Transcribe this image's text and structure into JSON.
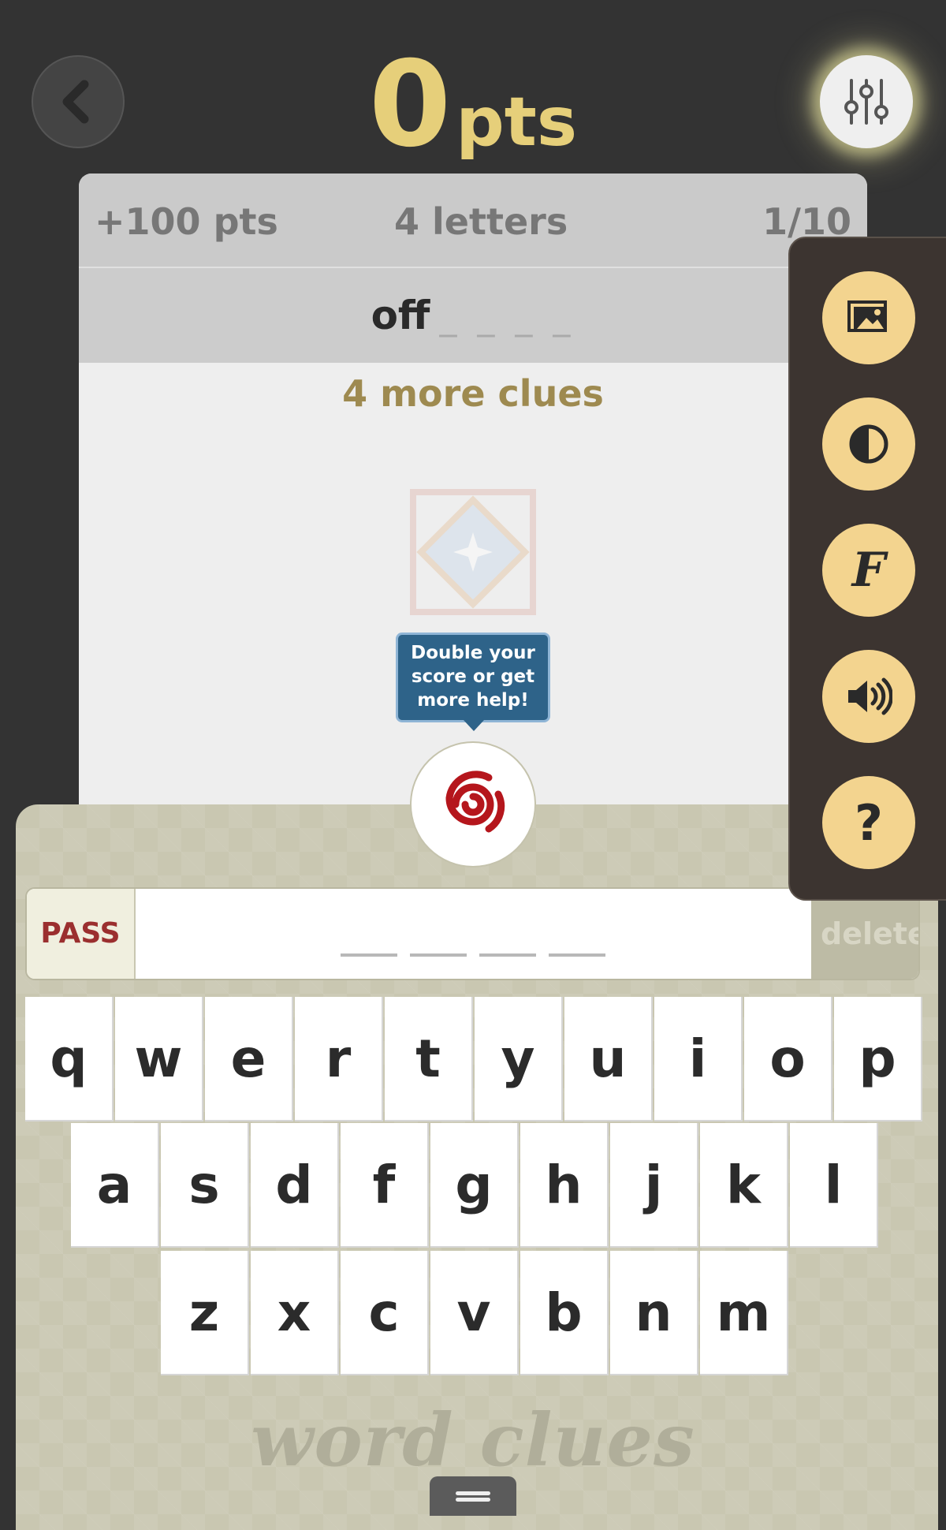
{
  "header": {
    "score_value": "0",
    "score_unit": "pts"
  },
  "card": {
    "points": "+100 pts",
    "letters": "4 letters",
    "progress": "1/10",
    "clue_word": "off",
    "clue_blank": "____",
    "more_clues": "4 more clues"
  },
  "tooltip": {
    "lines": [
      "Double your",
      "score or get",
      "more help!"
    ]
  },
  "answer": {
    "pass_label": "PASS",
    "delete_label": "delete",
    "slots": 4
  },
  "keyboard": {
    "row1": [
      "q",
      "w",
      "e",
      "r",
      "t",
      "y",
      "u",
      "i",
      "o",
      "p"
    ],
    "row2": [
      "a",
      "s",
      "d",
      "f",
      "g",
      "h",
      "j",
      "k",
      "l"
    ],
    "row3": [
      "z",
      "x",
      "c",
      "v",
      "b",
      "n",
      "m"
    ]
  },
  "brand": "word clues",
  "side_menu": {
    "items": [
      {
        "icon": "image-icon"
      },
      {
        "icon": "contrast-icon"
      },
      {
        "icon": "font-icon",
        "glyph": "F"
      },
      {
        "icon": "sound-icon"
      },
      {
        "icon": "help-icon",
        "glyph": "?"
      }
    ]
  },
  "colors": {
    "score": "#e6cf7a",
    "accent_gold": "#9e8a50",
    "pass_red": "#9b2f2f",
    "tooltip_blue": "#2e6389",
    "side_button": "#f3d48f"
  }
}
